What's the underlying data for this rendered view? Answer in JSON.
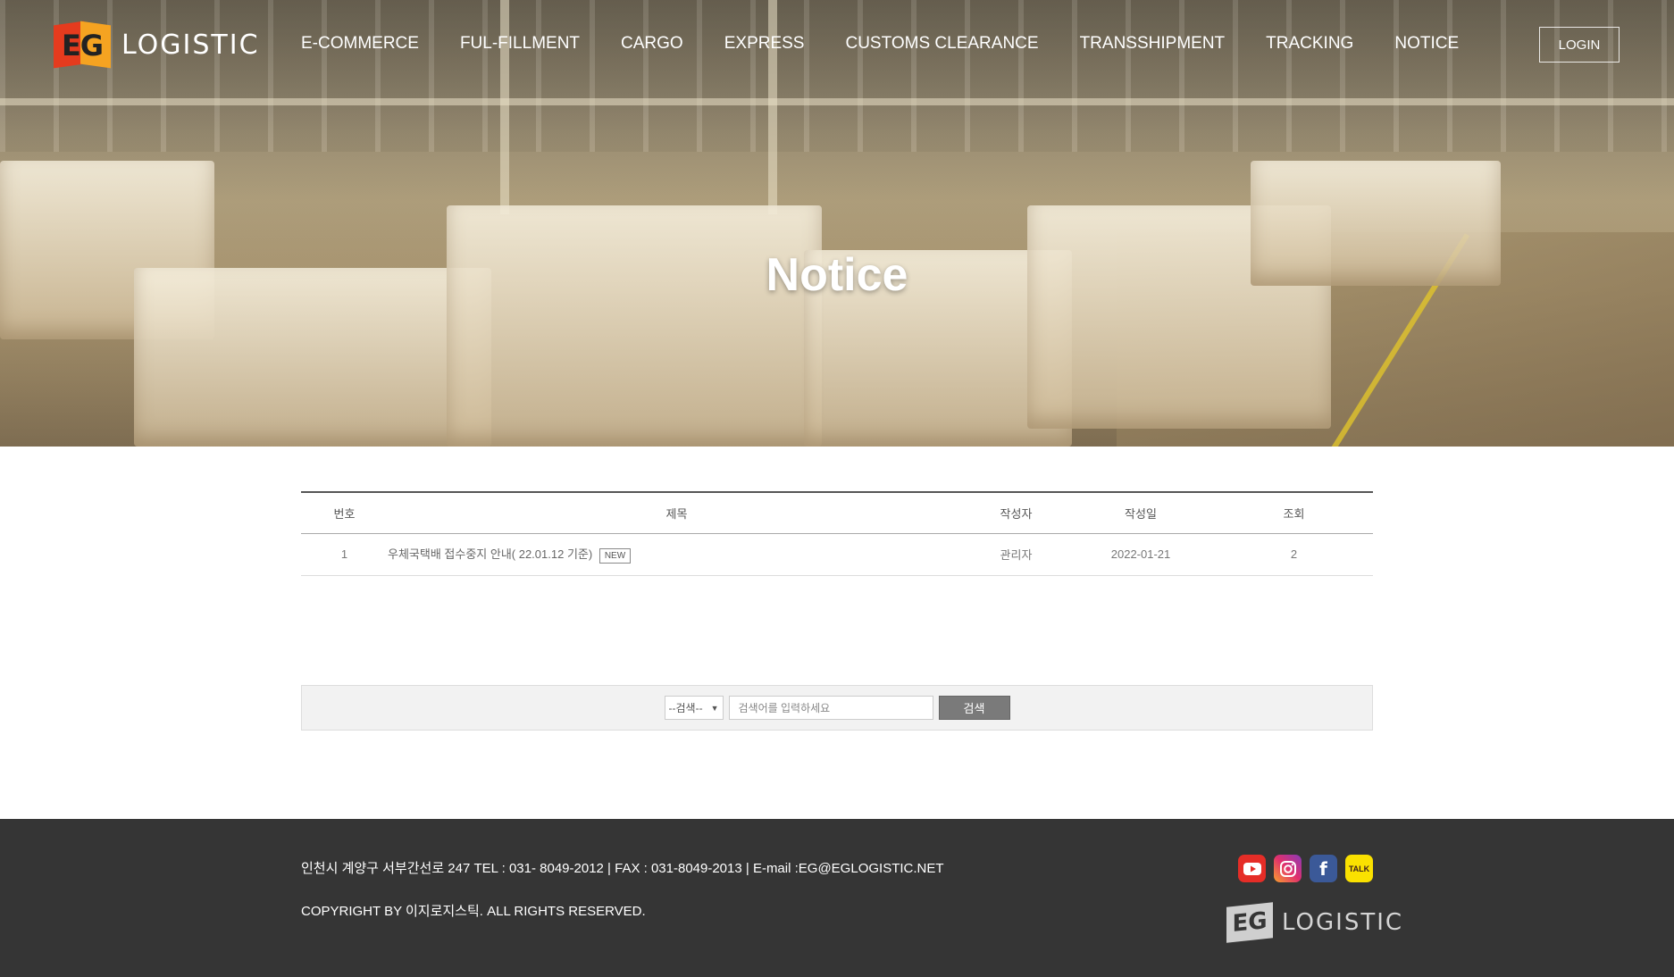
{
  "header": {
    "logo_mark": "EG",
    "logo_text": "LOGISTIC",
    "nav": [
      "E-COMMERCE",
      "FUL-FILLMENT",
      "CARGO",
      "EXPRESS",
      "CUSTOMS CLEARANCE",
      "TRANSSHIPMENT",
      "TRACKING",
      "NOTICE"
    ],
    "login_label": "LOGIN"
  },
  "hero": {
    "title": "Notice"
  },
  "board": {
    "columns": [
      "번호",
      "제목",
      "작성자",
      "작성일",
      "조회"
    ],
    "rows": [
      {
        "no": "1",
        "title": "우체국택배 접수중지 안내( 22.01.12 기준)",
        "badge": "NEW",
        "author": "관리자",
        "date": "2022-01-21",
        "views": "2"
      }
    ]
  },
  "search": {
    "select_value": "--검색--",
    "input_placeholder": "검색어를 입력하세요",
    "button_label": "검색"
  },
  "footer": {
    "address": "인천시 계양구 서부간선로 247 TEL : 031- 8049-2012 | FAX : 031-8049-2013 | E-mail :EG@EGLOGISTIC.NET",
    "copyright": "COPYRIGHT BY 이지로지스틱. ALL RIGHTS RESERVED.",
    "socials": [
      "youtube-icon",
      "instagram-icon",
      "facebook-icon",
      "kakaotalk-icon"
    ],
    "talk_label": "TALK",
    "logo_mark": "EG",
    "logo_text": "LOGISTIC"
  },
  "colors": {
    "logo_red": "#e53b1e",
    "logo_orange": "#f5a321",
    "footer_bg": "#353535",
    "search_btn": "#7a7a7a"
  }
}
